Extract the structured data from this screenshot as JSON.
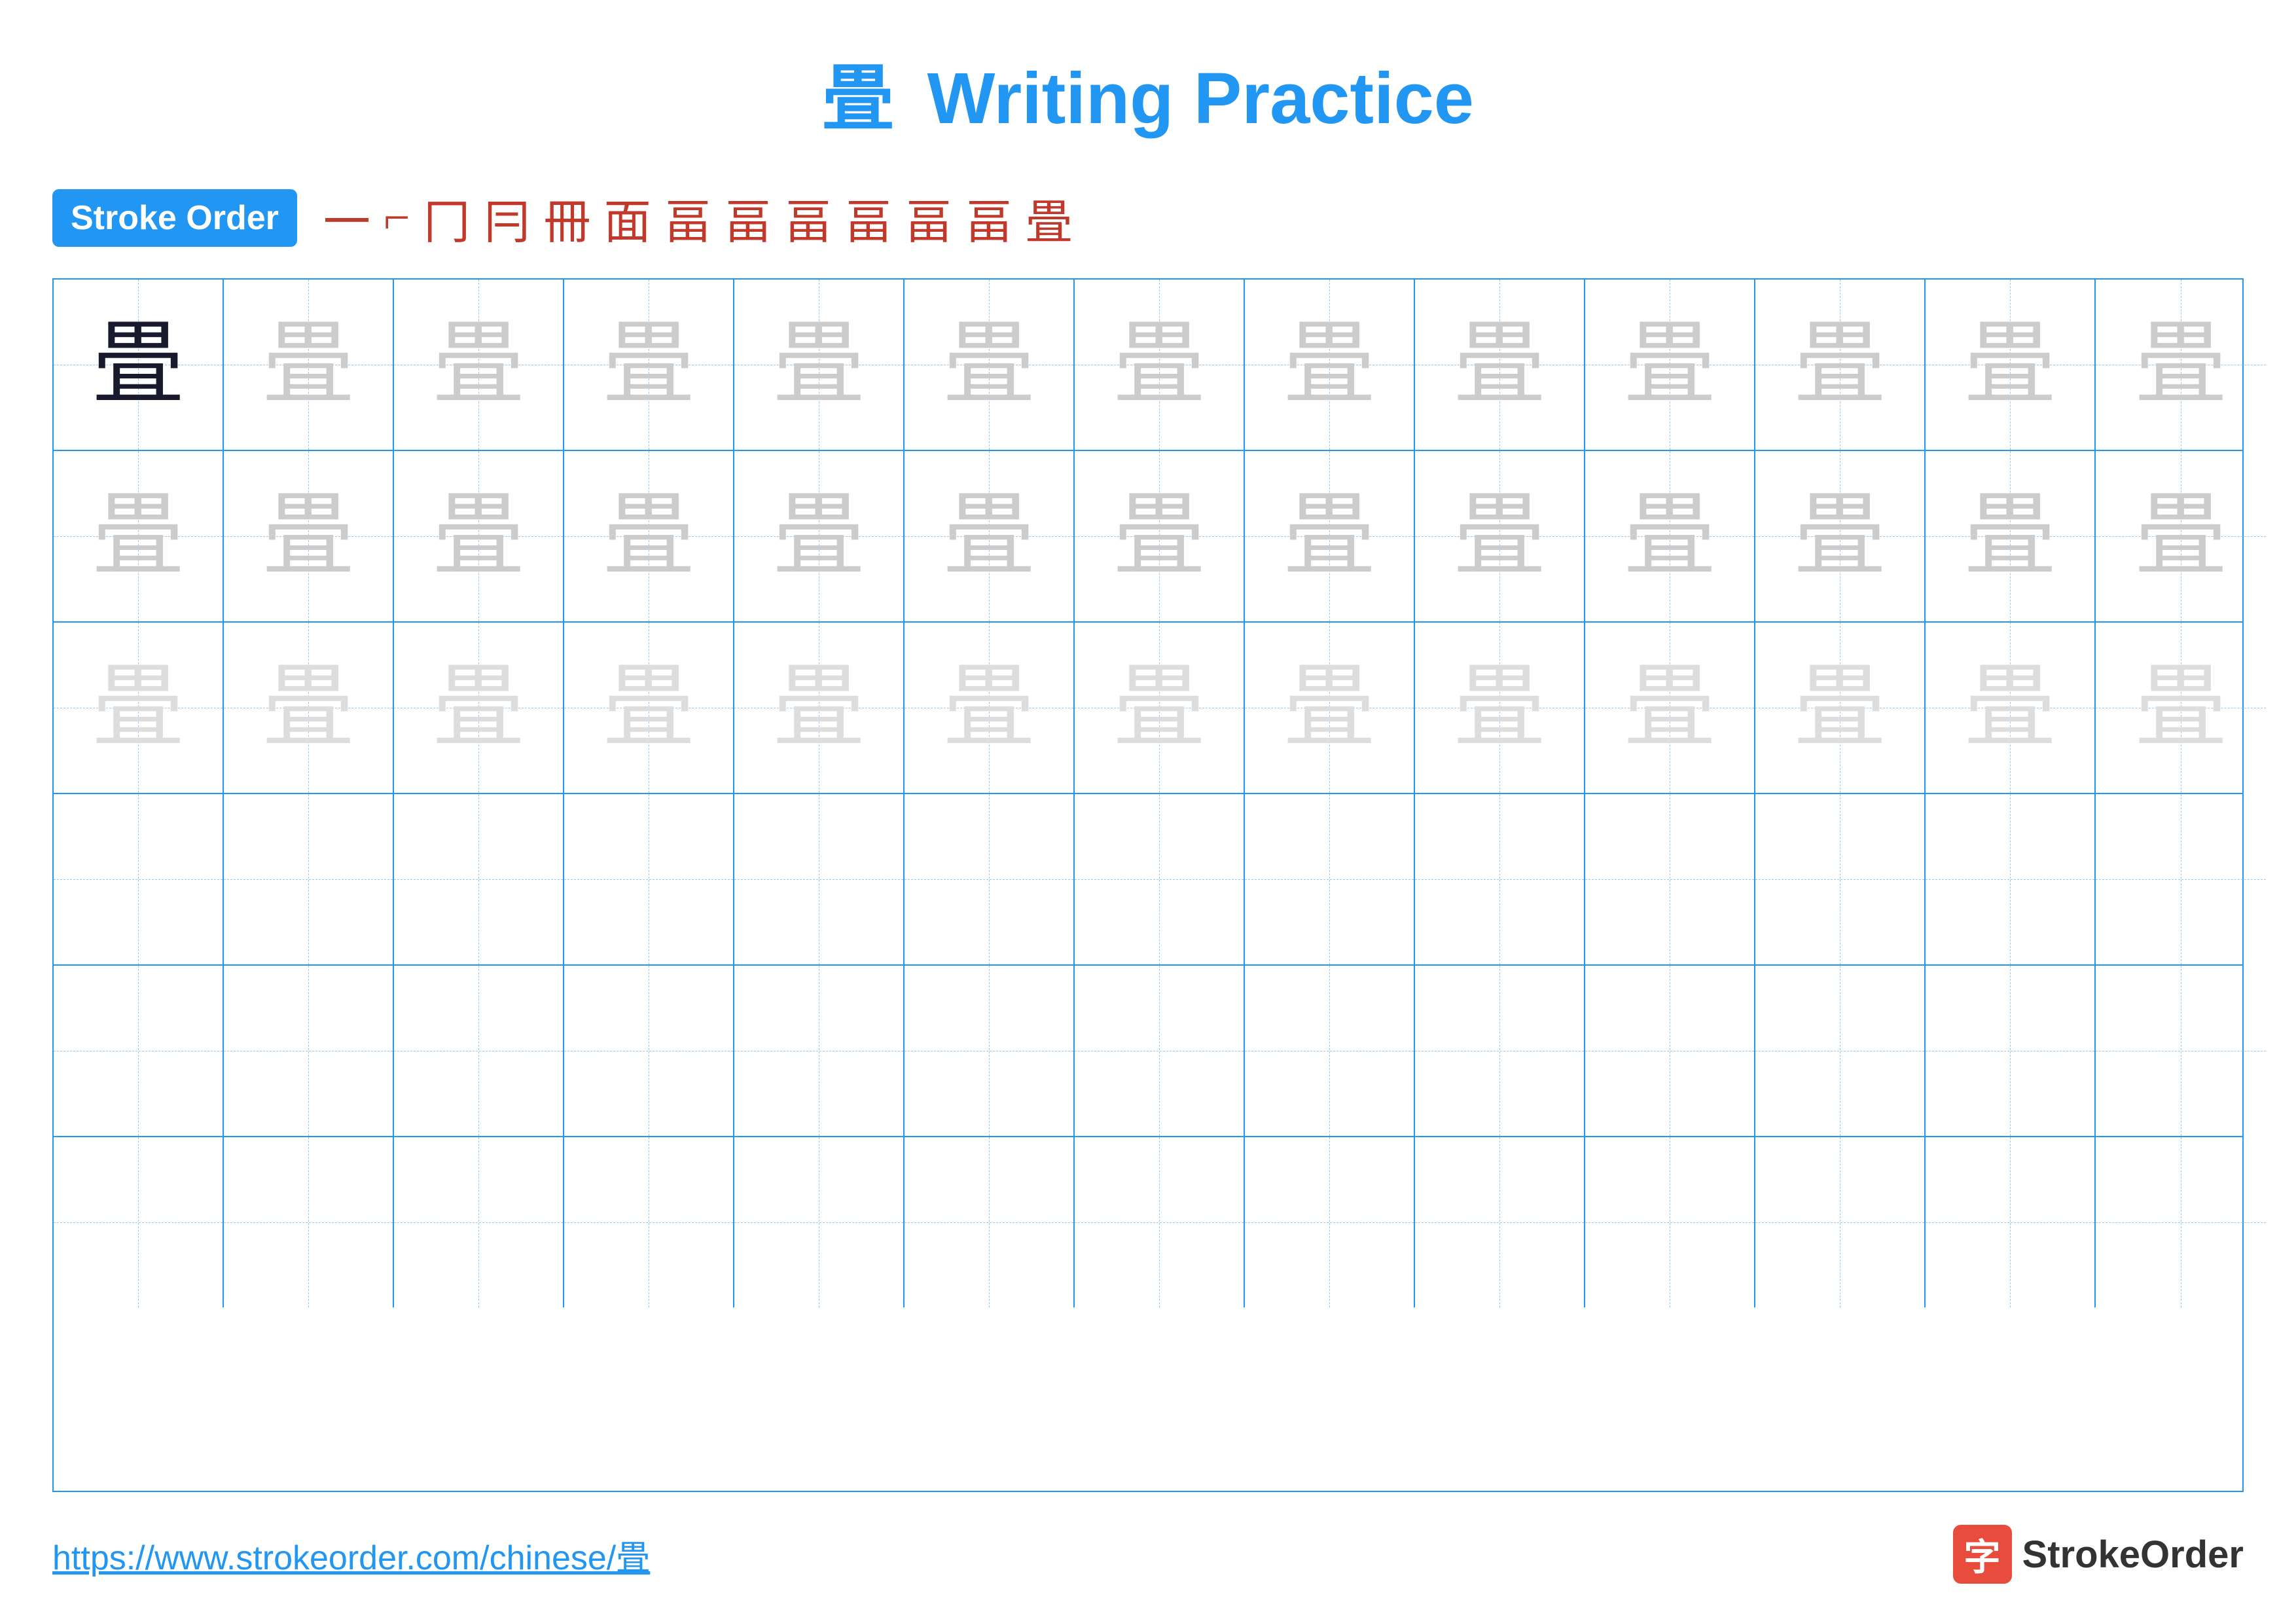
{
  "title": {
    "character": "畳",
    "text": "Writing Practice"
  },
  "stroke_order": {
    "badge_label": "Stroke Order",
    "strokes": [
      "一",
      "⌐",
      "冂",
      "冇",
      "冊",
      "面",
      "画",
      "畐",
      "畐",
      "畐",
      "畐",
      "畐",
      "畳"
    ]
  },
  "grid": {
    "rows": 6,
    "cols": 13,
    "character": "畳",
    "dark_row": 0,
    "light_rows": [
      1,
      2
    ],
    "empty_rows": [
      3,
      4,
      5
    ]
  },
  "footer": {
    "url": "https://www.strokeorder.com/chinese/畳",
    "brand_name": "StrokeOrder",
    "brand_char": "字"
  }
}
